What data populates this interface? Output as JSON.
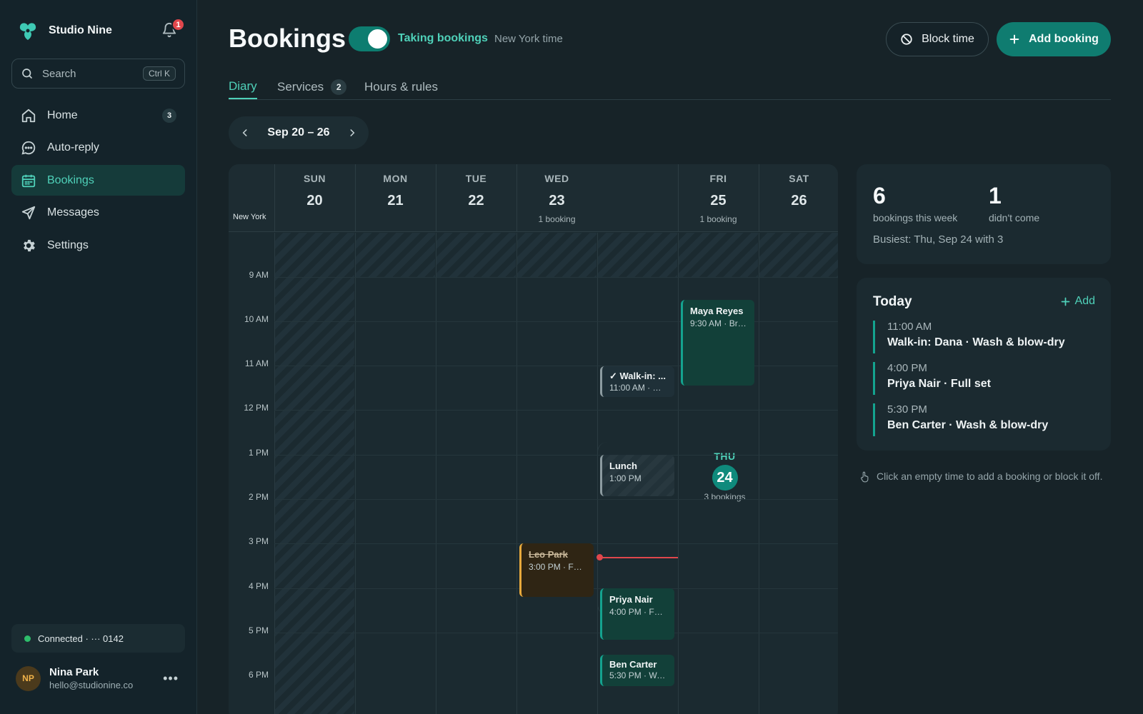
{
  "sidebar": {
    "brand": "Studio Nine",
    "notifications": "1",
    "search": {
      "label": "Search",
      "shortcut": "Ctrl K"
    },
    "items": [
      {
        "label": "Home",
        "badge": "3",
        "icon": "home-icon"
      },
      {
        "label": "Auto-reply",
        "badge": "",
        "icon": "chat-icon"
      },
      {
        "label": "Bookings",
        "badge": "",
        "icon": "calendar-icon",
        "active": true
      },
      {
        "label": "Messages",
        "badge": "",
        "icon": "send-icon"
      },
      {
        "label": "Settings",
        "badge": "",
        "icon": "gear-icon"
      }
    ],
    "connection": "Connected · ··· 0142",
    "user": {
      "initials": "NP",
      "name": "Nina Park",
      "email": "hello@studionine.co"
    }
  },
  "header": {
    "title": "Bookings",
    "toggle_label": "Taking bookings",
    "timezone": "New York time",
    "block_label": "Block time",
    "add_label": "Add booking"
  },
  "tabs": [
    {
      "label": "Diary",
      "count": ""
    },
    {
      "label": "Services",
      "count": "2"
    },
    {
      "label": "Hours & rules",
      "count": ""
    }
  ],
  "date_range": "Sep 20 – 26",
  "calendar": {
    "timezone_label": "New York",
    "days": [
      {
        "name": "SUN",
        "num": "20",
        "sub": ""
      },
      {
        "name": "MON",
        "num": "21",
        "sub": ""
      },
      {
        "name": "TUE",
        "num": "22",
        "sub": ""
      },
      {
        "name": "WED",
        "num": "23",
        "sub": "1 booking"
      },
      {
        "name": "THU",
        "num": "24",
        "sub": "3 bookings",
        "today": true
      },
      {
        "name": "FRI",
        "num": "25",
        "sub": "1 booking"
      },
      {
        "name": "SAT",
        "num": "26",
        "sub": ""
      }
    ],
    "hours": [
      "9 AM",
      "10 AM",
      "11 AM",
      "12 PM",
      "1 PM",
      "2 PM",
      "3 PM",
      "4 PM",
      "5 PM",
      "6 PM"
    ],
    "events": [
      {
        "title": "Maya Reyes",
        "sub": "9:30 AM · Bra..."
      },
      {
        "title": "✓ Walk-in: ...",
        "sub": "11:00 AM · W..."
      },
      {
        "title": "Lunch",
        "sub": "1:00 PM"
      },
      {
        "title": "Leo Park",
        "sub": "3:00 PM · Full..."
      },
      {
        "title": "Priya Nair",
        "sub": "4:00 PM · Full..."
      },
      {
        "title": "Ben Carter",
        "sub": "5:30 PM · Wa..."
      }
    ]
  },
  "stats": {
    "week_count": "6",
    "week_label": "bookings this week",
    "noshow_count": "1",
    "noshow_label": "didn't come",
    "busiest": "Busiest: Thu, Sep 24 with 3"
  },
  "today": {
    "title": "Today",
    "add_label": "Add",
    "appointments": [
      {
        "time": "11:00 AM",
        "desc": "Walk-in: Dana · Wash & blow-dry"
      },
      {
        "time": "4:00 PM",
        "desc": "Priya Nair · Full set"
      },
      {
        "time": "5:30 PM",
        "desc": "Ben Carter · Wash & blow-dry"
      }
    ]
  },
  "hint": "Click an empty time to add a booking or block it off.",
  "colors": {
    "accent": "#4fd1b9",
    "primary": "#0f7c70",
    "alert": "#e0474c",
    "warning": "#e8a93c"
  }
}
